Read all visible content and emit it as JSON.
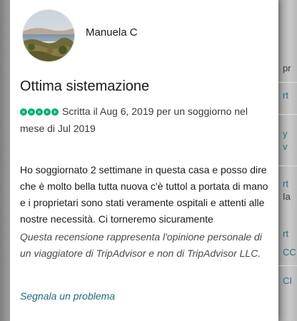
{
  "review": {
    "author": "Manuela C",
    "title": "Ottima sistemazione",
    "rating": 5,
    "rating_max": 5,
    "meta_text": "Scritta il Aug 6, 2019 per un soggiorno nel mese di Jul 2019",
    "body": "Ho soggiornato 2 settimane in questa casa e posso dire che è molto bella tutta nuova c'è tuttol a portata di mano e i proprietari sono stati veramente ospitali e attenti alle nostre necessità. Ci torneremo sicuramente",
    "disclaimer": "Questa recensione rappresenta l'opinione personale di un viaggiatore di TripAdvisor e non di TripAdvisor LLC.",
    "report_label": "Segnala un problema"
  },
  "background_fragments": [
    "pr",
    "rt",
    "y",
    "v",
    "rt",
    "Ia",
    "rt",
    "CC",
    "CI"
  ],
  "colors": {
    "bubble": "#00aa6c",
    "link": "#1d6b80"
  },
  "icons": {
    "rating": "green-bubble-icon",
    "avatar": "user-avatar-photo"
  }
}
